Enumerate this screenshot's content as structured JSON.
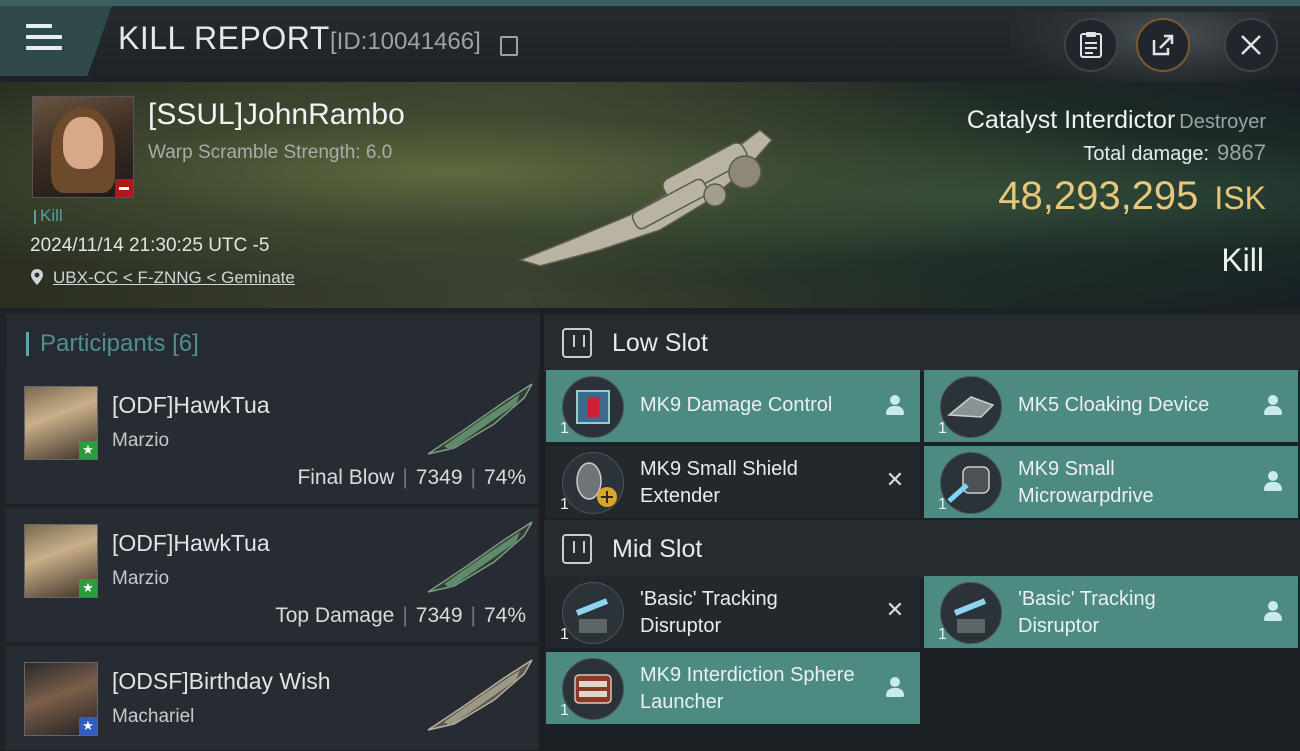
{
  "header": {
    "title": "KILL REPORT",
    "report_id": "[ID:10041466]"
  },
  "victim": {
    "name": "[SSUL]JohnRambo",
    "warp_scramble": "Warp Scramble Strength: 6.0",
    "tag": "Kill",
    "timestamp": "2024/11/14 21:30:25 UTC -5",
    "location": "UBX-CC < F-ZNNG < Geminate",
    "ship_name": "Catalyst Interdictor",
    "ship_class": "Destroyer",
    "total_damage_label": "Total damage:",
    "total_damage": "9867",
    "isk_value": "48,293,295",
    "isk_unit": "ISK",
    "result": "Kill"
  },
  "participants": {
    "label": "Participants",
    "count": "[6]",
    "items": [
      {
        "name": "[ODF]HawkTua",
        "ship": "Marzio",
        "role": "Final Blow",
        "damage": "7349",
        "percent": "74%",
        "badge_color": "#2e9c3e"
      },
      {
        "name": "[ODF]HawkTua",
        "ship": "Marzio",
        "role": "Top Damage",
        "damage": "7349",
        "percent": "74%",
        "badge_color": "#2e9c3e"
      },
      {
        "name": "[ODSF]Birthday Wish",
        "ship": "Machariel",
        "role": "",
        "damage": "",
        "percent": "",
        "badge_color": "#2f5fc4"
      }
    ]
  },
  "fittings": {
    "low_slot": {
      "label": "Low Slot",
      "modules": [
        {
          "name": "MK9 Damage Control",
          "qty": "1",
          "state": "fitted"
        },
        {
          "name": "MK5 Cloaking Device",
          "qty": "1",
          "state": "fitted"
        },
        {
          "name": "MK9 Small Shield Extender",
          "qty": "1",
          "state": "destroyed"
        },
        {
          "name": "MK9 Small Microwarpdrive",
          "qty": "1",
          "state": "fitted"
        }
      ]
    },
    "mid_slot": {
      "label": "Mid Slot",
      "modules": [
        {
          "name": "'Basic' Tracking Disruptor",
          "qty": "1",
          "state": "destroyed"
        },
        {
          "name": "'Basic' Tracking Disruptor",
          "qty": "1",
          "state": "fitted"
        },
        {
          "name": "MK9 Interdiction Sphere Launcher",
          "qty": "1",
          "state": "fitted"
        }
      ]
    }
  },
  "icons": {
    "menu": "hamburger-menu-icon",
    "clipboard": "clipboard-icon",
    "share": "share-icon",
    "close": "close-icon",
    "location": "location-pin-icon",
    "copy": "copy-icon"
  },
  "colors": {
    "accent": "#4d8a82",
    "isk": "#e8c77a",
    "negative_badge": "#b0181b"
  }
}
